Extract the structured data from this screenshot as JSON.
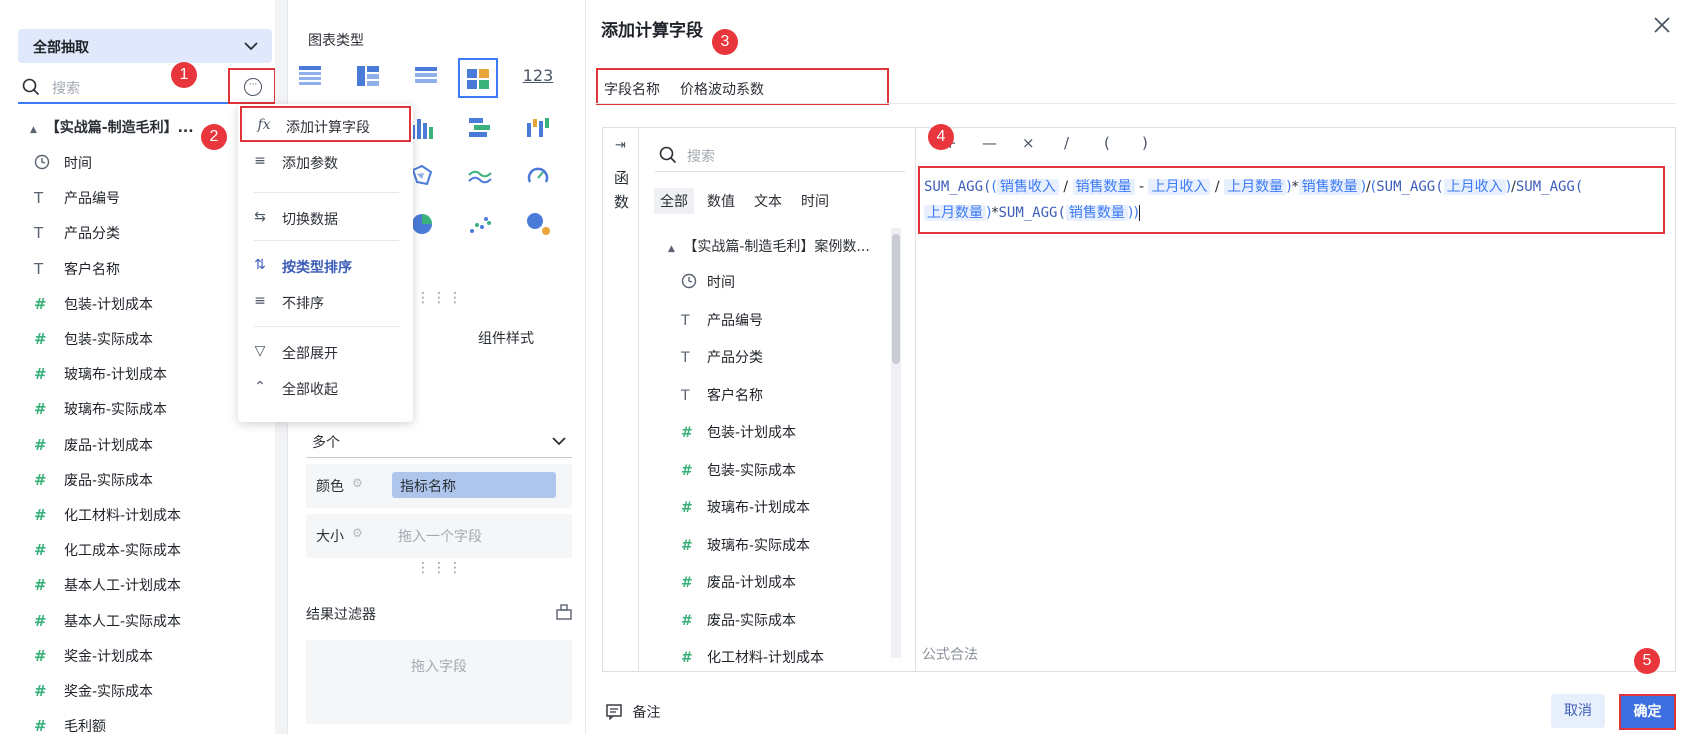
{
  "left_panel": {
    "scope_label": "全部抽取",
    "search_placeholder": "搜索",
    "dataset_title": "【实战篇-制造毛利】...",
    "fields": [
      {
        "type": "time",
        "icon": "clock-icon",
        "label": "时间"
      },
      {
        "type": "text",
        "icon": "T",
        "label": "产品编号"
      },
      {
        "type": "text",
        "icon": "T",
        "label": "产品分类"
      },
      {
        "type": "text",
        "icon": "T",
        "label": "客户名称"
      },
      {
        "type": "number",
        "icon": "#",
        "label": "包装-计划成本"
      },
      {
        "type": "number",
        "icon": "#",
        "label": "包装-实际成本"
      },
      {
        "type": "number",
        "icon": "#",
        "label": "玻璃布-计划成本"
      },
      {
        "type": "number",
        "icon": "#",
        "label": "玻璃布-实际成本"
      },
      {
        "type": "number",
        "icon": "#",
        "label": "废品-计划成本"
      },
      {
        "type": "number",
        "icon": "#",
        "label": "废品-实际成本"
      },
      {
        "type": "number",
        "icon": "#",
        "label": "化工材料-计划成本"
      },
      {
        "type": "number",
        "icon": "#",
        "label": "化工成本-实际成本"
      },
      {
        "type": "number",
        "icon": "#",
        "label": "基本人工-计划成本"
      },
      {
        "type": "number",
        "icon": "#",
        "label": "基本人工-实际成本"
      },
      {
        "type": "number",
        "icon": "#",
        "label": "奖金-计划成本"
      },
      {
        "type": "number",
        "icon": "#",
        "label": "奖金-实际成本"
      },
      {
        "type": "number",
        "icon": "#",
        "label": "毛利额"
      }
    ]
  },
  "menu": {
    "items": [
      {
        "icon": "fx",
        "label": "添加计算字段"
      },
      {
        "icon": "≡",
        "label": "添加参数"
      },
      {
        "icon": "⇆",
        "label": "切换数据"
      },
      {
        "icon": "⇅",
        "label": "按类型排序"
      },
      {
        "icon": "≡",
        "label": "不排序"
      },
      {
        "icon": "▽",
        "label": "全部展开"
      },
      {
        "icon": "⌃",
        "label": "全部收起"
      }
    ]
  },
  "middle_panel": {
    "chart_type_title": "图表类型",
    "numeric_chart_icon_text": "123",
    "tab_style": "组件样式",
    "dropdown_value": "多个",
    "color_label": "颜色",
    "color_value": "指标名称",
    "size_label": "大小",
    "size_placeholder": "拖入一个字段",
    "filter_title": "结果过滤器",
    "filter_placeholder": "拖入字段"
  },
  "dialog": {
    "title": "添加计算字段",
    "field_name_label": "字段名称",
    "field_name_value": "价格波动系数",
    "functions_label": "函数",
    "search_placeholder": "搜索",
    "tabs": [
      "全部",
      "数值",
      "文本",
      "时间"
    ],
    "dataset_title": "【实战篇-制造毛利】案例数...",
    "fields": [
      {
        "icon": "clock",
        "label": "时间"
      },
      {
        "icon": "T",
        "label": "产品编号"
      },
      {
        "icon": "T",
        "label": "产品分类"
      },
      {
        "icon": "T",
        "label": "客户名称"
      },
      {
        "icon": "#",
        "label": "包装-计划成本"
      },
      {
        "icon": "#",
        "label": "包装-实际成本"
      },
      {
        "icon": "#",
        "label": "玻璃布-计划成本"
      },
      {
        "icon": "#",
        "label": "玻璃布-实际成本"
      },
      {
        "icon": "#",
        "label": "废品-计划成本"
      },
      {
        "icon": "#",
        "label": "废品-实际成本"
      },
      {
        "icon": "#",
        "label": "化工材料-计划成本"
      }
    ],
    "operators": [
      "+",
      "—",
      "×",
      "/",
      "(",
      ")"
    ],
    "formula": {
      "fn1": "SUM_AGG(",
      "t_sales": "销售收入",
      "t_qty": "销售数量",
      "t_last_sales": "上月收入",
      "t_last_qty": "上月数量",
      "fn2": "SUM_AGG("
    },
    "status": "公式合法",
    "note_label": "备注",
    "cancel_label": "取消",
    "ok_label": "确定"
  },
  "badges": [
    "1",
    "2",
    "3",
    "4",
    "5"
  ],
  "colors": {
    "accent": "#3d7af5",
    "highlight": "#e0343b",
    "number_icon": "#3ab07a"
  }
}
